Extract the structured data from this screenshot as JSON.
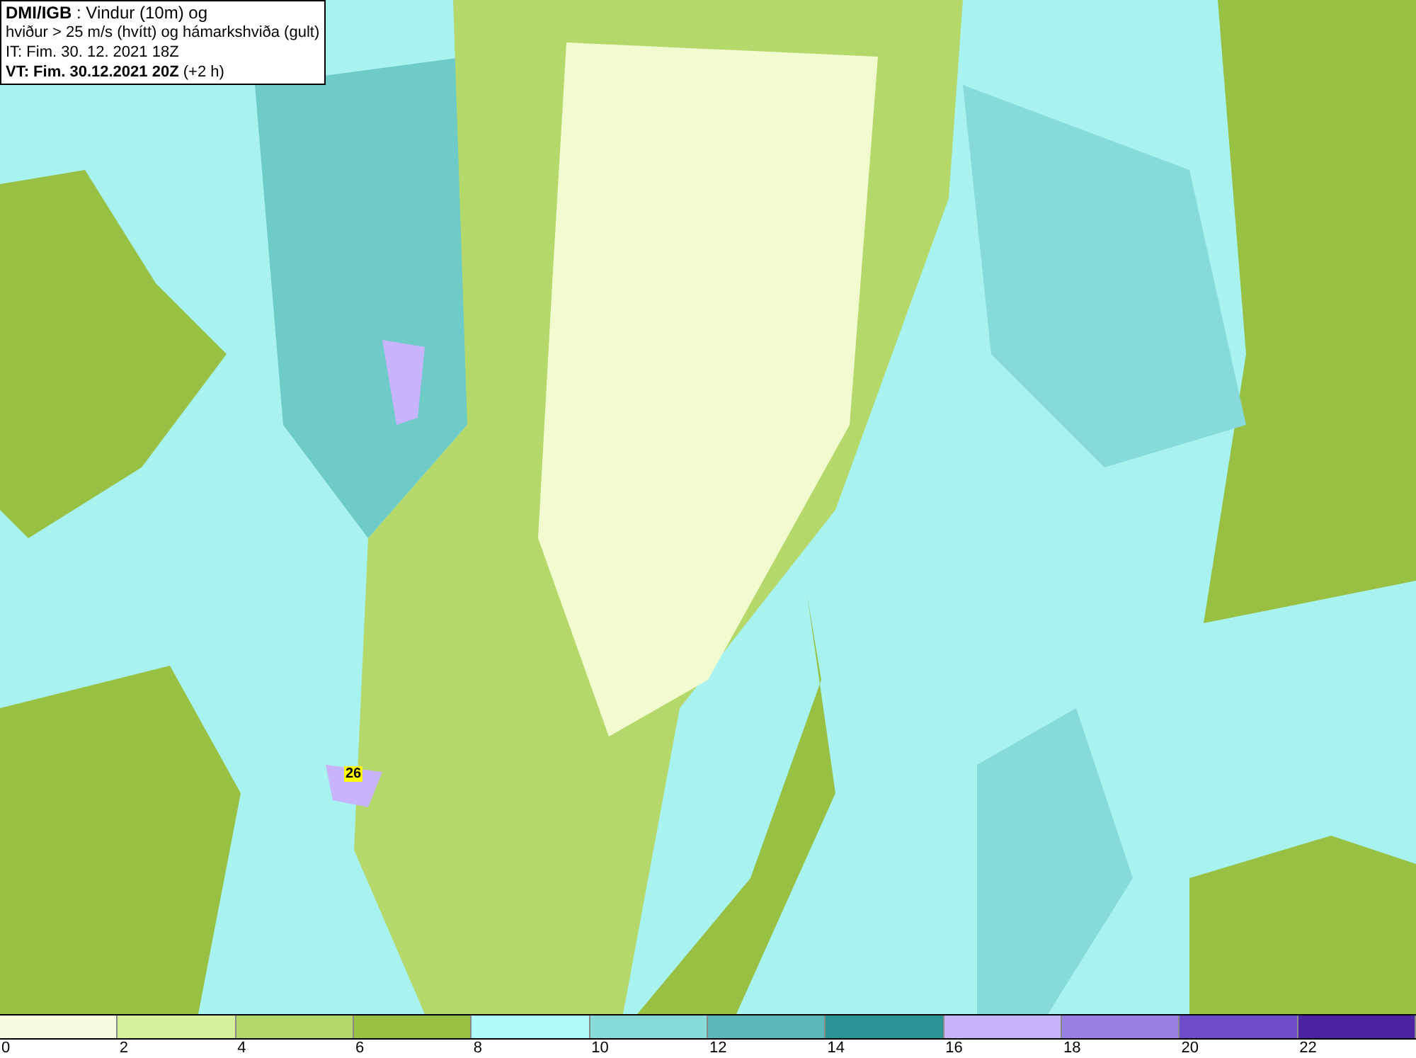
{
  "title_box": {
    "lines": [
      "**DMI/IGB** : Vindur (10m) og",
      "hviður > 25 m/s (hvítt) og hámarkshviða (gult)",
      "IT: Fim. 30. 12. 2021 18Z",
      "**VT: Fim. 30.12.2021 20Z** (+2 h)"
    ]
  },
  "map": {
    "gust_labels": [
      {
        "text": "26"
      }
    ]
  },
  "legend": {
    "bins": [
      {
        "color": "#f7fde0"
      },
      {
        "color": "#d6ef9a"
      },
      {
        "color": "#b5d86a"
      },
      {
        "color": "#98c143"
      },
      {
        "color": "#aefcfc"
      },
      {
        "color": "#86dada"
      },
      {
        "color": "#5ab8b8"
      },
      {
        "color": "#2a9494"
      },
      {
        "color": "#c8b4fa"
      },
      {
        "color": "#9a80e4"
      },
      {
        "color": "#6e4cc8"
      },
      {
        "color": "#4a24a0"
      }
    ],
    "ticks": [
      "0",
      "2",
      "4",
      "6",
      "8",
      "10",
      "12",
      "14",
      "16",
      "18",
      "20",
      "22"
    ]
  }
}
